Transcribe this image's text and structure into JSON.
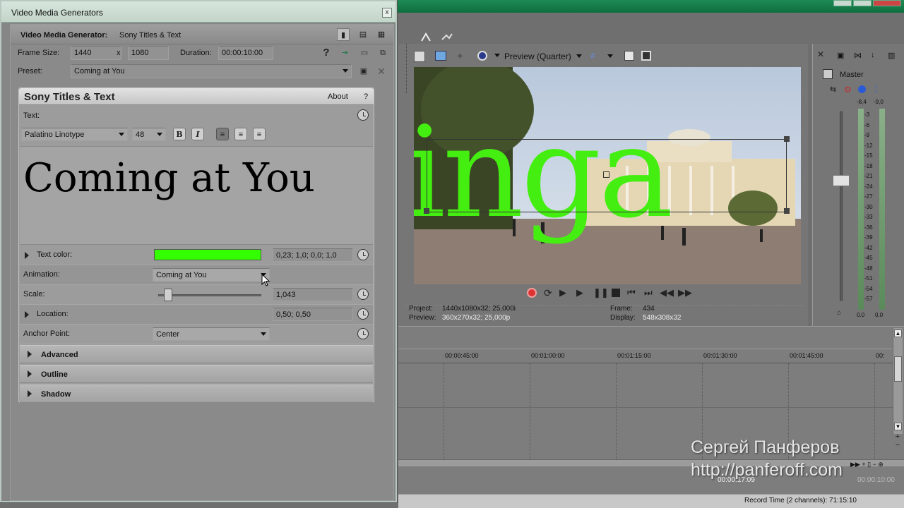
{
  "dialog": {
    "title": "Video Media Generators",
    "close_label": "x",
    "generator_label": "Video Media Generator:",
    "generator_name": "Sony Titles & Text",
    "frame_size_label": "Frame Size:",
    "frame_width": "1440",
    "frame_sep": "x",
    "frame_height": "1080",
    "duration_label": "Duration:",
    "duration_value": "00:00:10:00",
    "preset_label": "Preset:",
    "preset_value": "Coming at You",
    "help_glyph": "?"
  },
  "plugin": {
    "title": "Sony Titles & Text",
    "about_label": "About",
    "help_label": "?",
    "text_label": "Text:",
    "font_name": "Palatino Linotype",
    "font_size": "48",
    "bold": "B",
    "italic": "I",
    "text_content": "Coming at You",
    "text_color_label": "Text color:",
    "text_color_value": "0,23; 1,0; 0,0; 1,0",
    "text_color_swatch": "#33ff00",
    "animation_label": "Animation:",
    "animation_value": "Coming at You",
    "scale_label": "Scale:",
    "scale_value": "1,043",
    "location_label": "Location:",
    "location_value": "0,50; 0,50",
    "anchor_label": "Anchor Point:",
    "anchor_value": "Center",
    "sections": [
      "Advanced",
      "Outline",
      "Shadow"
    ]
  },
  "preview": {
    "quality_label": "Preview (Quarter)",
    "overlay_text": "inga",
    "project_label": "Project:",
    "project_value": "1440x1080x32; 25,000i",
    "preview_label": "Preview:",
    "preview_value": "360x270x32; 25,000p",
    "frame_label": "Frame:",
    "frame_value": "434",
    "display_label": "Display:",
    "display_value": "548x308x32"
  },
  "mixer": {
    "title": "Master",
    "peak_left": "-8,4",
    "peak_right": "-9,0",
    "scale": [
      "3",
      "6",
      "9",
      "12",
      "15",
      "18",
      "21",
      "24",
      "27",
      "30",
      "33",
      "36",
      "39",
      "42",
      "45",
      "48",
      "51",
      "54",
      "57"
    ],
    "bottom_left": "0.0",
    "bottom_right": "0.0",
    "bottom_right2": "0.0"
  },
  "timeline": {
    "ticks": [
      "00:00:45:00",
      "00:01:00:00",
      "00:01:15:00",
      "00:01:30:00",
      "00:01:45:00",
      "00:"
    ],
    "position": "00:00:17:09",
    "end_time": "00:00:10:00"
  },
  "status": {
    "record_time": "Record Time (2 channels): 71:15:10"
  },
  "watermark": {
    "name": "Сергей Панферов",
    "url": "http://panferoff.com"
  }
}
